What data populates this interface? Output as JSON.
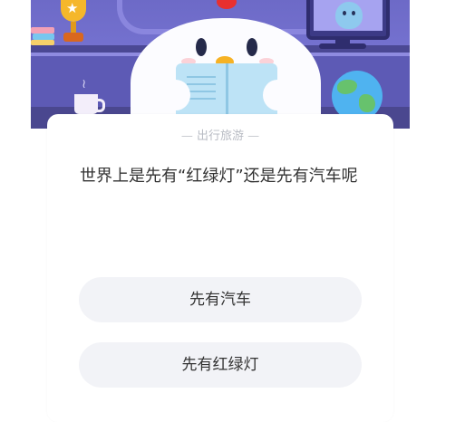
{
  "quiz": {
    "category_label": "出行旅游",
    "question": "世界上是先有“红绿灯”还是先有汽车呢",
    "options": [
      {
        "label": "先有汽车"
      },
      {
        "label": "先有红绿灯"
      }
    ]
  },
  "colors": {
    "banner_purple": "#6c69c9",
    "card_bg": "#ffffff",
    "option_bg": "#f2f3f7",
    "text_primary": "#333333",
    "text_muted": "#b9bcc4"
  },
  "icons": [
    "trophy-icon",
    "books-icon",
    "monitor-icon",
    "mug-icon",
    "globe-icon",
    "chicken-mascot"
  ]
}
